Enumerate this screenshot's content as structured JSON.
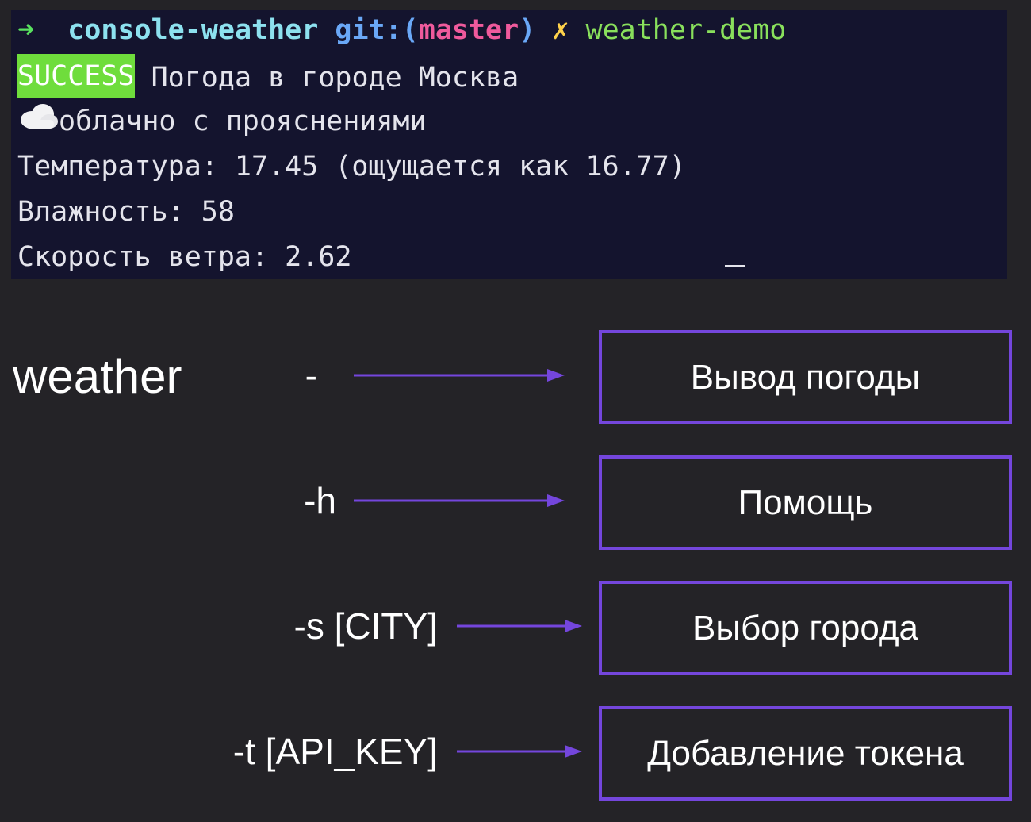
{
  "terminal": {
    "prompt_arrow": "➜",
    "repo": "console-weather",
    "git_label": "git:",
    "paren_open": "(",
    "branch": "master",
    "paren_close": ")",
    "dirty_mark": "✗",
    "command": "weather-demo",
    "success_badge": "SUCCESS",
    "line_city": " Погода в городе Москва",
    "condition": "облачно с прояснениями",
    "temperature": "Температура: 17.45 (ощущается как 16.77)",
    "humidity": "Влажность: 58",
    "wind": "Скорость ветра: 2.62",
    "icon": "cloud-icon"
  },
  "diagram": {
    "cli_name": "weather",
    "rows": [
      {
        "flag": "-",
        "action": "Вывод погоды"
      },
      {
        "flag": "-h",
        "action": "Помощь"
      },
      {
        "flag": "-s [CITY]",
        "action": "Выбор города"
      },
      {
        "flag": "-t [API_KEY]",
        "action": "Добавление токена"
      }
    ]
  },
  "colors": {
    "background": "#242327",
    "terminal_bg": "#14142e",
    "accent": "#7446dc",
    "success": "#6fdd3c"
  }
}
